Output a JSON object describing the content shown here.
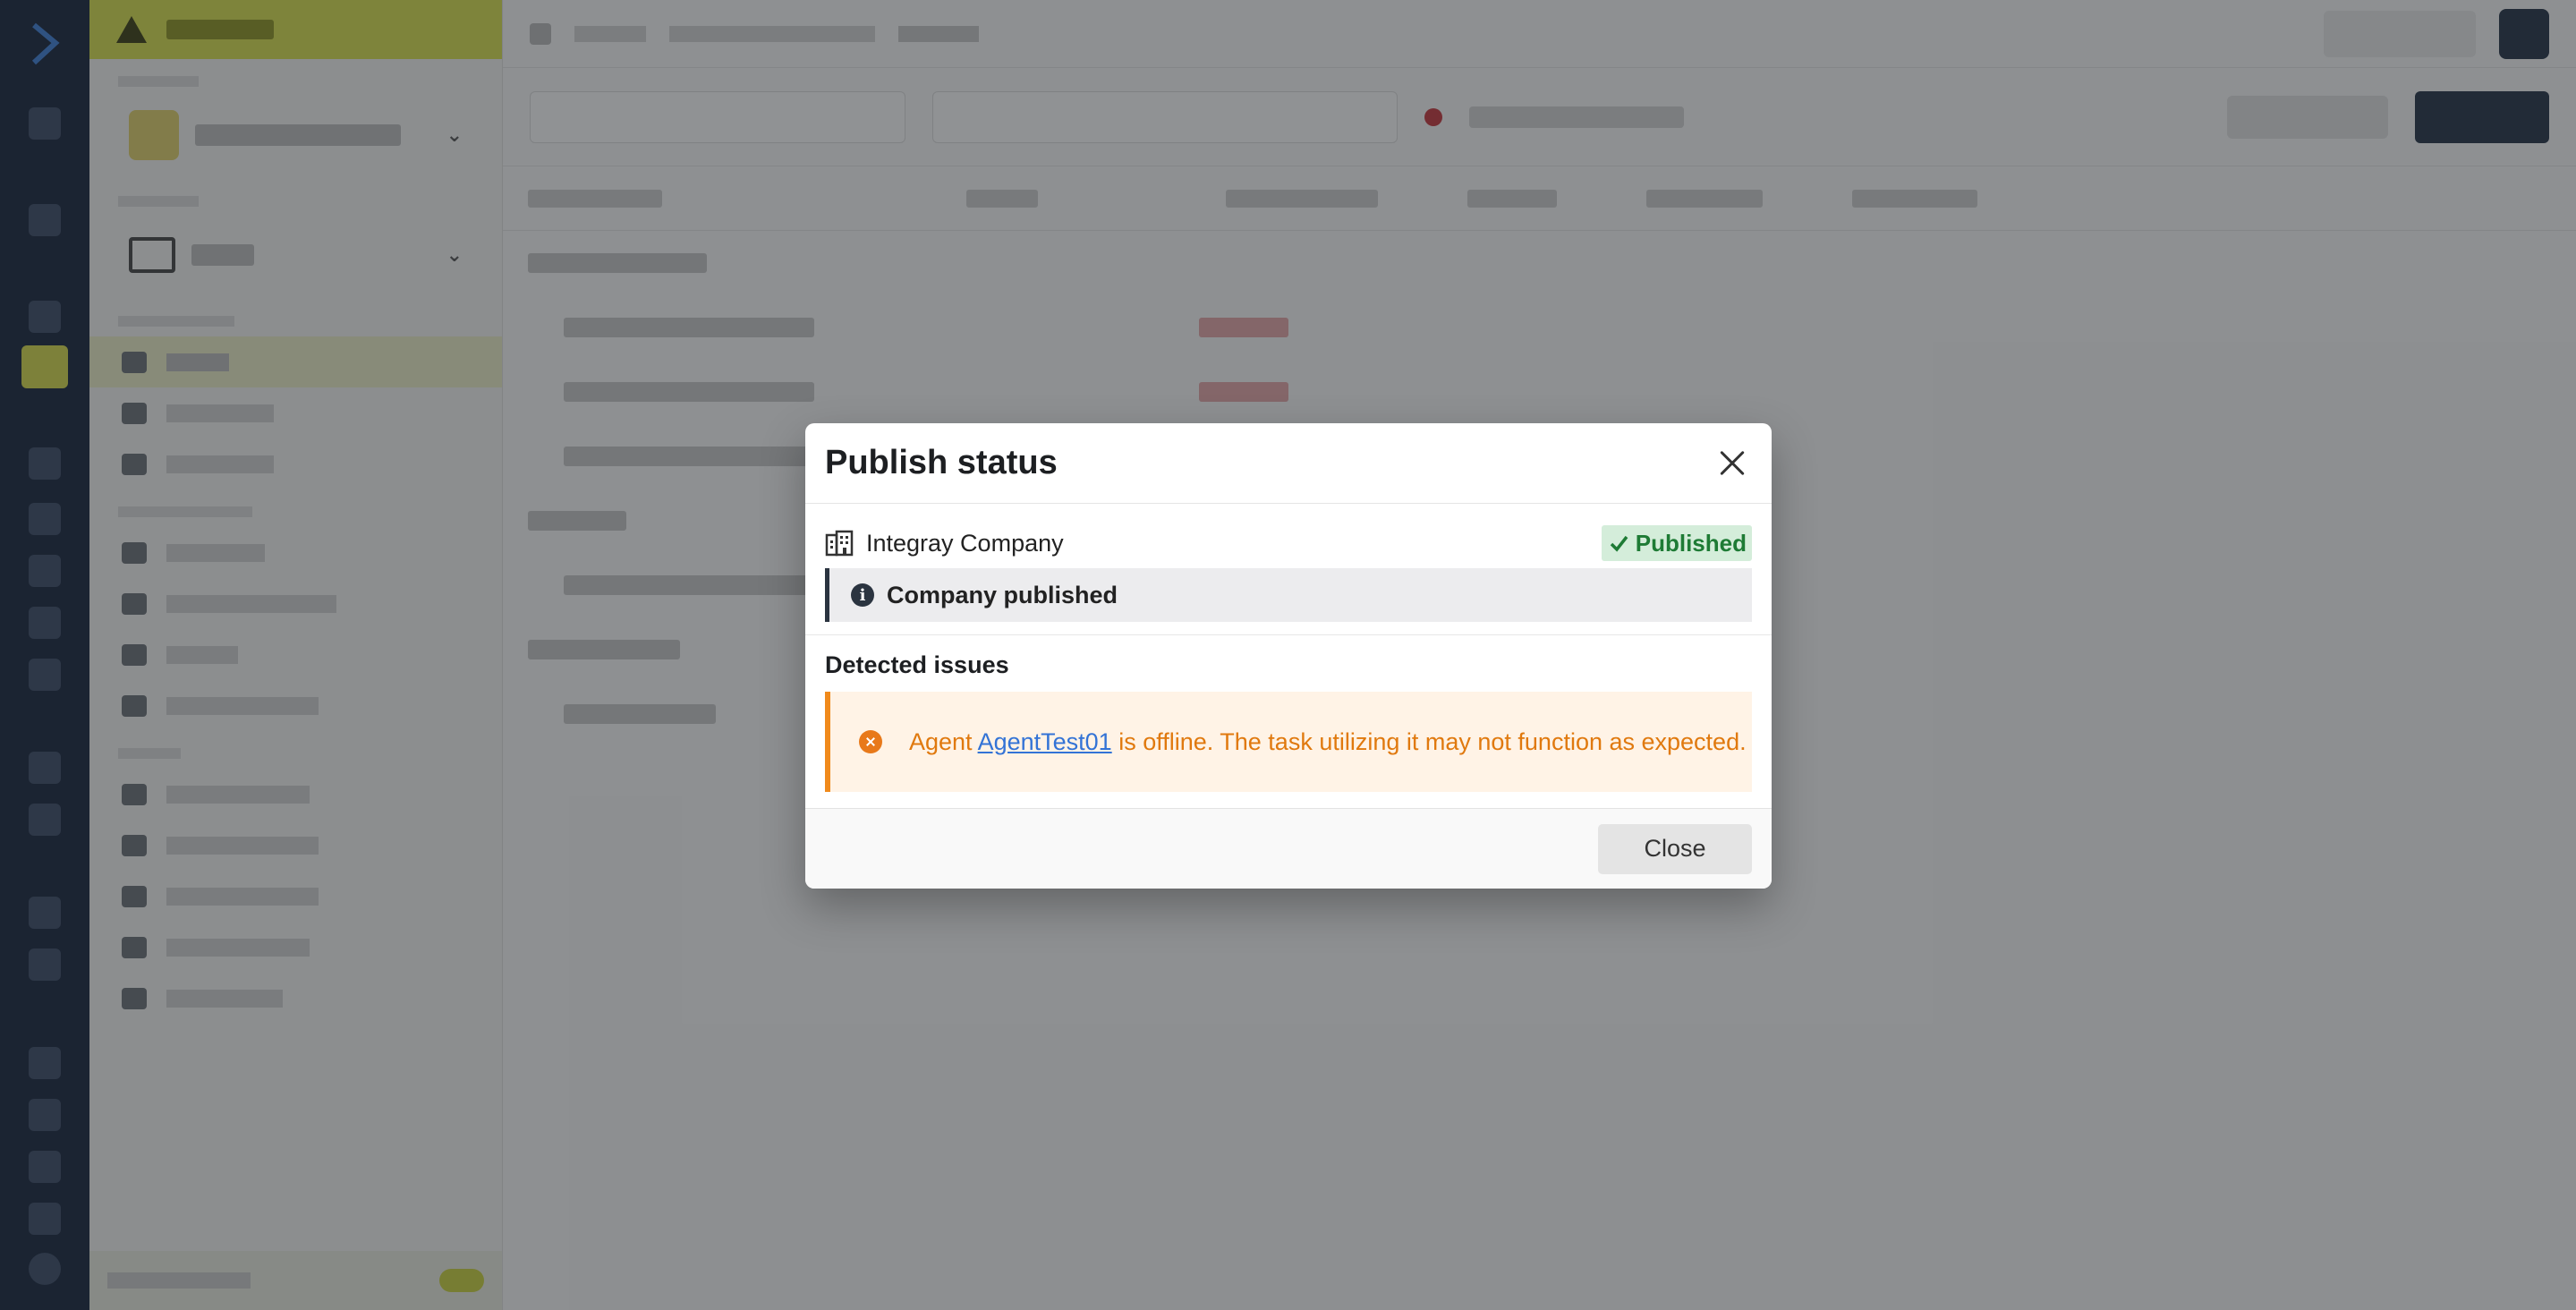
{
  "modal": {
    "title": "Publish status",
    "company_name": "Integray Company",
    "status_badge": "Published",
    "info_message": "Company published",
    "issues_heading": "Detected issues",
    "issue": {
      "prefix": "Agent",
      "agent_name": "AgentTest01",
      "suffix": "is offline. The task utilizing it may not function as expected."
    },
    "close_label": "Close"
  },
  "colors": {
    "success_bg": "#d4edda",
    "success_text": "#1e7b35",
    "warning_accent": "#f08a1c",
    "warning_text": "#e0790e",
    "link": "#3373d6",
    "sandbox_accent": "#dbe24d"
  }
}
